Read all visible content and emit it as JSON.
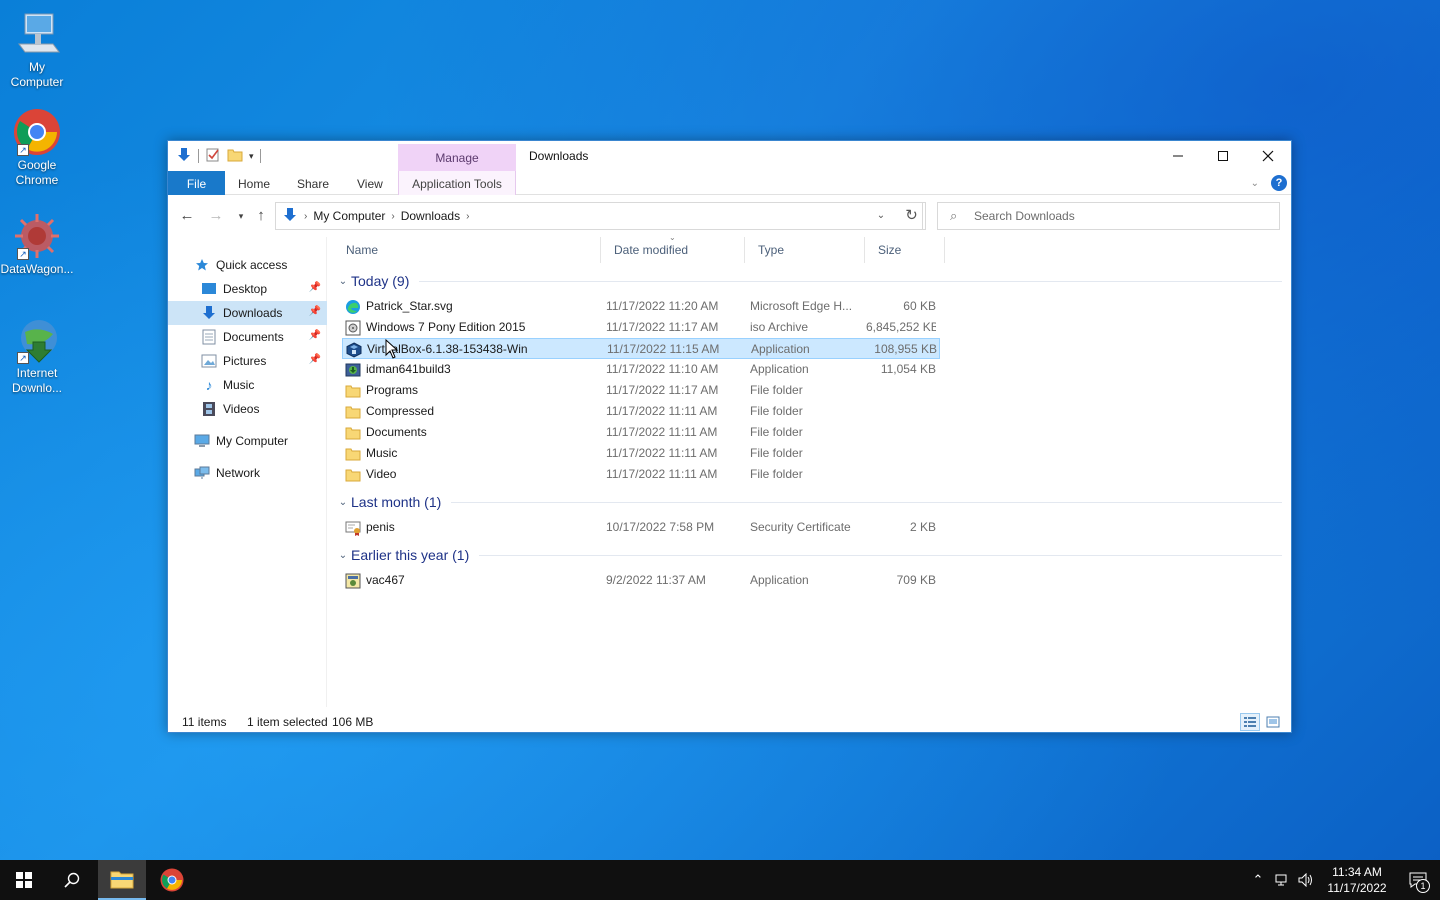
{
  "desktop": {
    "icons": [
      {
        "label": "My\nComputer",
        "icon": "computer-icon"
      },
      {
        "label": "Google\nChrome",
        "icon": "chrome-icon"
      },
      {
        "label": "DataWagon...",
        "icon": "datawagon-icon"
      },
      {
        "label": "Internet\nDownlo...",
        "icon": "internet-download-manager-icon"
      }
    ]
  },
  "window": {
    "title": "Downloads",
    "context_tab": "Manage",
    "ribbon_tabs": {
      "file": "File",
      "home": "Home",
      "share": "Share",
      "view": "View",
      "application_tools": "Application Tools"
    }
  },
  "address": {
    "crumbs": [
      "My Computer",
      "Downloads"
    ]
  },
  "search": {
    "placeholder": "Search Downloads"
  },
  "navpane": {
    "quick_access": "Quick access",
    "items": [
      {
        "label": "Desktop",
        "pinned": true
      },
      {
        "label": "Downloads",
        "pinned": true,
        "selected": true
      },
      {
        "label": "Documents",
        "pinned": true
      },
      {
        "label": "Pictures",
        "pinned": true
      },
      {
        "label": "Music",
        "pinned": false
      },
      {
        "label": "Videos",
        "pinned": false
      }
    ],
    "my_computer": "My Computer",
    "network": "Network"
  },
  "columns": {
    "name": "Name",
    "date": "Date modified",
    "type": "Type",
    "size": "Size"
  },
  "groups": [
    {
      "label": "Today (9)",
      "files": [
        {
          "name": "Patrick_Star.svg",
          "date": "11/17/2022 11:20 AM",
          "type": "Microsoft Edge H...",
          "size": "60 KB",
          "icon": "edge-icon"
        },
        {
          "name": "Windows 7 Pony Edition 2015",
          "date": "11/17/2022 11:17 AM",
          "type": "iso Archive",
          "size": "6,845,252 KB",
          "icon": "iso-archive-icon"
        },
        {
          "name": "VirtualBox-6.1.38-153438-Win",
          "date": "11/17/2022 11:15 AM",
          "type": "Application",
          "size": "108,955 KB",
          "icon": "virtualbox-icon",
          "selected": true
        },
        {
          "name": "idman641build3",
          "date": "11/17/2022 11:10 AM",
          "type": "Application",
          "size": "11,054 KB",
          "icon": "idm-installer-icon"
        },
        {
          "name": "Programs",
          "date": "11/17/2022 11:17 AM",
          "type": "File folder",
          "size": "",
          "icon": "folder-icon"
        },
        {
          "name": "Compressed",
          "date": "11/17/2022 11:11 AM",
          "type": "File folder",
          "size": "",
          "icon": "folder-icon"
        },
        {
          "name": "Documents",
          "date": "11/17/2022 11:11 AM",
          "type": "File folder",
          "size": "",
          "icon": "folder-icon"
        },
        {
          "name": "Music",
          "date": "11/17/2022 11:11 AM",
          "type": "File folder",
          "size": "",
          "icon": "folder-icon"
        },
        {
          "name": "Video",
          "date": "11/17/2022 11:11 AM",
          "type": "File folder",
          "size": "",
          "icon": "folder-icon"
        }
      ]
    },
    {
      "label": "Last month (1)",
      "files": [
        {
          "name": "penis",
          "date": "10/17/2022 7:58 PM",
          "type": "Security Certificate",
          "size": "2 KB",
          "icon": "certificate-icon"
        }
      ]
    },
    {
      "label": "Earlier this year (1)",
      "files": [
        {
          "name": "vac467",
          "date": "9/2/2022 11:37 AM",
          "type": "Application",
          "size": "709 KB",
          "icon": "application-icon"
        }
      ]
    }
  ],
  "status": {
    "items": "11 items",
    "selected": "1 item selected",
    "size": "106 MB"
  },
  "taskbar": {
    "time": "11:34 AM",
    "date": "11/17/2022",
    "notification_count": "1"
  },
  "colors": {
    "accent": "#1979ca",
    "selection": "#cce8ff",
    "manage_tab": "#f0d3f7",
    "taskbar": "#101010"
  }
}
